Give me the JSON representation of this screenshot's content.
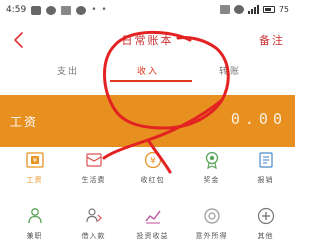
{
  "status_bar": {
    "time": "4:59",
    "battery": "75"
  },
  "header": {
    "title": "日常账本",
    "action": "备注"
  },
  "tabs": [
    {
      "label": "支出"
    },
    {
      "label": "收入"
    },
    {
      "label": "转账"
    }
  ],
  "active_tab": 1,
  "banner": {
    "label": "工资",
    "amount": "0.00"
  },
  "categories": [
    {
      "label": "工资",
      "icon": "wallet-icon",
      "highlighted": true
    },
    {
      "label": "生活费",
      "icon": "envelope-icon"
    },
    {
      "label": "收红包",
      "icon": "yen-coin-icon"
    },
    {
      "label": "奖金",
      "icon": "medal-icon"
    },
    {
      "label": "报销",
      "icon": "receipt-icon"
    },
    {
      "label": "兼职",
      "icon": "person-icon"
    },
    {
      "label": "借入款",
      "icon": "transfer-person-icon"
    },
    {
      "label": "投资收益",
      "icon": "trend-chart-icon"
    },
    {
      "label": "意外所得",
      "icon": "gift-icon"
    },
    {
      "label": "其他",
      "icon": "plus-circle-icon"
    }
  ],
  "colors": {
    "accent": "#e7901f",
    "title_red": "#cc3333",
    "tab_active": "#e03a1e",
    "annotation": "#e32222"
  }
}
